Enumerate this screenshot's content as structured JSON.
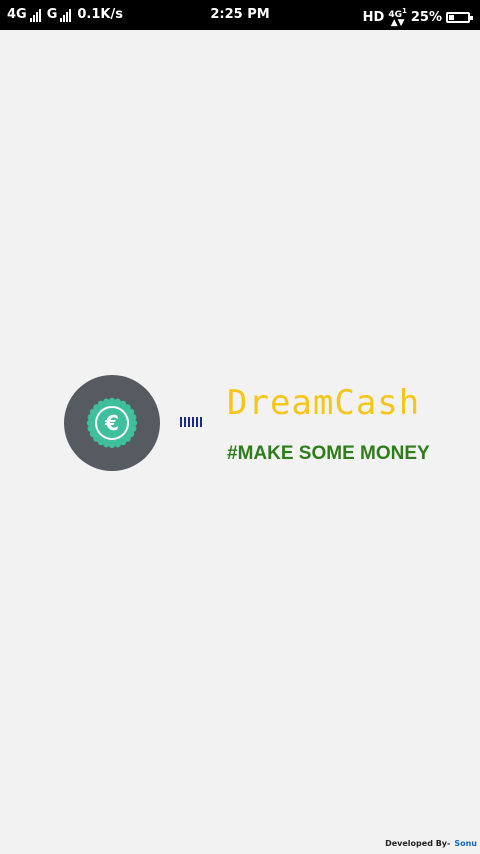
{
  "status_bar": {
    "network_left": "4G",
    "network_mid": "G",
    "speed": "0.1K/s",
    "time": "2:25 PM",
    "hd": "HD",
    "net_4g": "4G",
    "net_sub": "1",
    "battery_text": "25%",
    "battery_level": 0.25
  },
  "splash": {
    "logo_symbol": "€",
    "icon": "euro-coin-badge-icon",
    "title": "DreamCash",
    "tagline": "#MAKE SOME MONEY"
  },
  "footer": {
    "developed_by": "Developed By-",
    "developer": "Sonu"
  },
  "colors": {
    "background": "#f2f2f2",
    "status_bar": "#000000",
    "logo_circle": "#555b60",
    "badge": "#3fbf9c",
    "title": "#f5c518",
    "tagline": "#2f7d1a",
    "loader": "#1a2a8c",
    "developer": "#1565c0"
  }
}
